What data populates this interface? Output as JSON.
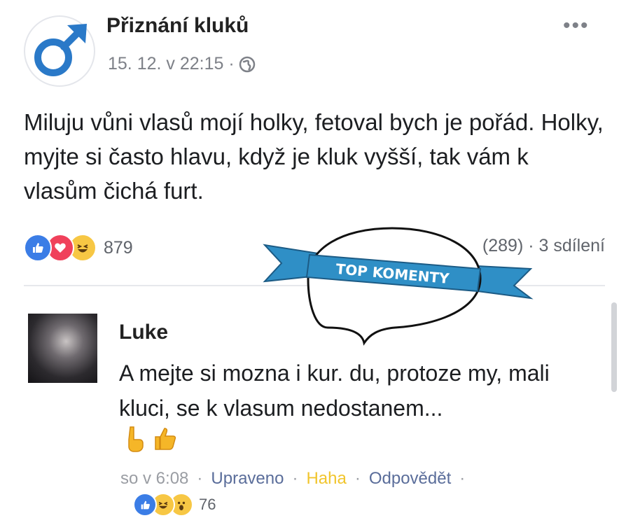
{
  "post": {
    "page_name": "Přiznání kluků",
    "time": "15. 12. v 22:15 ·",
    "text": "Miluju vůni vlasů mojí holky, fetoval bych je pořád. Holky, myjte si často hlavu, když je kluk vyšší, tak vám k vlasům čichá furt.",
    "reaction_count": "879",
    "share_stats": "(289) · 3 sdílení",
    "reactions": [
      "like-icon",
      "love-icon",
      "haha-icon"
    ]
  },
  "badge": {
    "text": "TOP KOMENTY"
  },
  "comment": {
    "author": "Luke",
    "text": "A mejte si mozna i kur. du, protoze my, mali kluci, se k vlasum nedostanem...",
    "emojis": [
      "point-down-hand-icon",
      "thumbs-up-hand-icon"
    ],
    "time": "so v 6:08",
    "edited_label": "Upraveno",
    "haha_label": "Haha",
    "reply_label": "Odpovědět",
    "reaction_count": "76",
    "reactions": [
      "like-icon",
      "haha-icon",
      "wow-icon"
    ]
  },
  "colors": {
    "link": "#5a6d9a",
    "like": "#3b7de6",
    "love": "#f0415b",
    "haha": "#f7c744",
    "badge_ribbon": "#2f8fc6"
  }
}
